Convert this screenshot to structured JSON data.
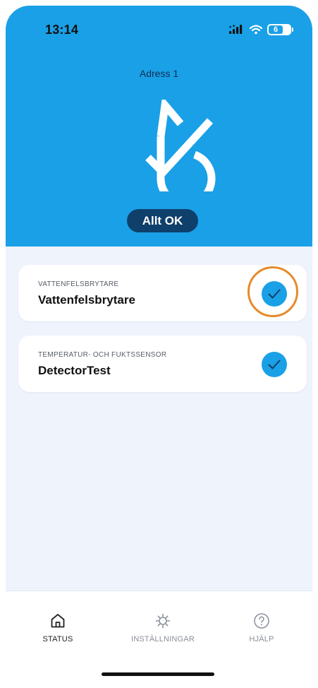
{
  "status_bar": {
    "time": "13:14",
    "battery_level": "6",
    "icons": [
      "signal-icon",
      "wifi-icon",
      "battery-icon"
    ]
  },
  "header": {
    "address": "Adress 1",
    "logo_icon": "droplet-check-icon",
    "status_label": "Allt OK"
  },
  "devices": [
    {
      "category": "VATTENFELSBRYTARE",
      "name": "Vattenfelsbrytare",
      "status_icon": "check-icon"
    },
    {
      "category": "TEMPERATUR- OCH FUKTSSENSOR",
      "name": "DetectorTest",
      "status_icon": "check-icon"
    }
  ],
  "tabs": [
    {
      "label": "STATUS",
      "icon": "home-icon",
      "active": true
    },
    {
      "label": "INSTÄLLNINGAR",
      "icon": "gear-icon",
      "active": false
    },
    {
      "label": "HJÄLP",
      "icon": "help-icon",
      "active": false
    }
  ],
  "colors": {
    "brand_blue": "#1aa0e6",
    "navy": "#0f3f6b",
    "background": "#eef3fc",
    "highlight": "#e58b2a"
  }
}
